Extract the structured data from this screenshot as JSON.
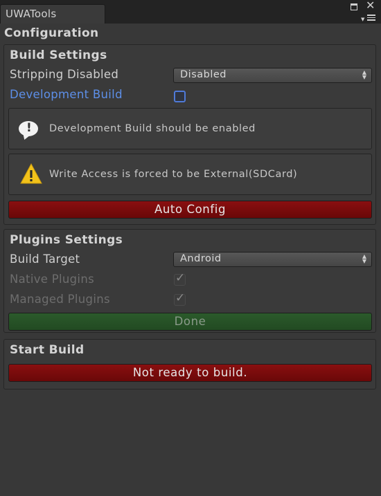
{
  "window": {
    "tab_title": "UWATools",
    "maximize_icon": "maximize-icon",
    "close_icon": "close-icon",
    "menu_icon": "context-menu-icon"
  },
  "page_title": "Configuration",
  "build_settings": {
    "title": "Build Settings",
    "stripping_label": "Stripping Disabled",
    "stripping_value": "Disabled",
    "dev_build_label": "Development Build",
    "dev_build_checked": false,
    "info_message": "Development Build should be enabled",
    "warning_message": "Write Access is forced to be External(SDCard)",
    "auto_config_label": "Auto Config"
  },
  "plugins_settings": {
    "title": "Plugins Settings",
    "build_target_label": "Build Target",
    "build_target_value": "Android",
    "native_plugins_label": "Native Plugins",
    "native_plugins_checked": true,
    "managed_plugins_label": "Managed Plugins",
    "managed_plugins_checked": true,
    "done_label": "Done"
  },
  "start_build": {
    "title": "Start Build",
    "status_button_label": "Not ready to build."
  },
  "colors": {
    "background": "#383838",
    "accent_blue": "#5d8fe8",
    "button_red": "#7a0c0d",
    "button_green": "#285228"
  }
}
